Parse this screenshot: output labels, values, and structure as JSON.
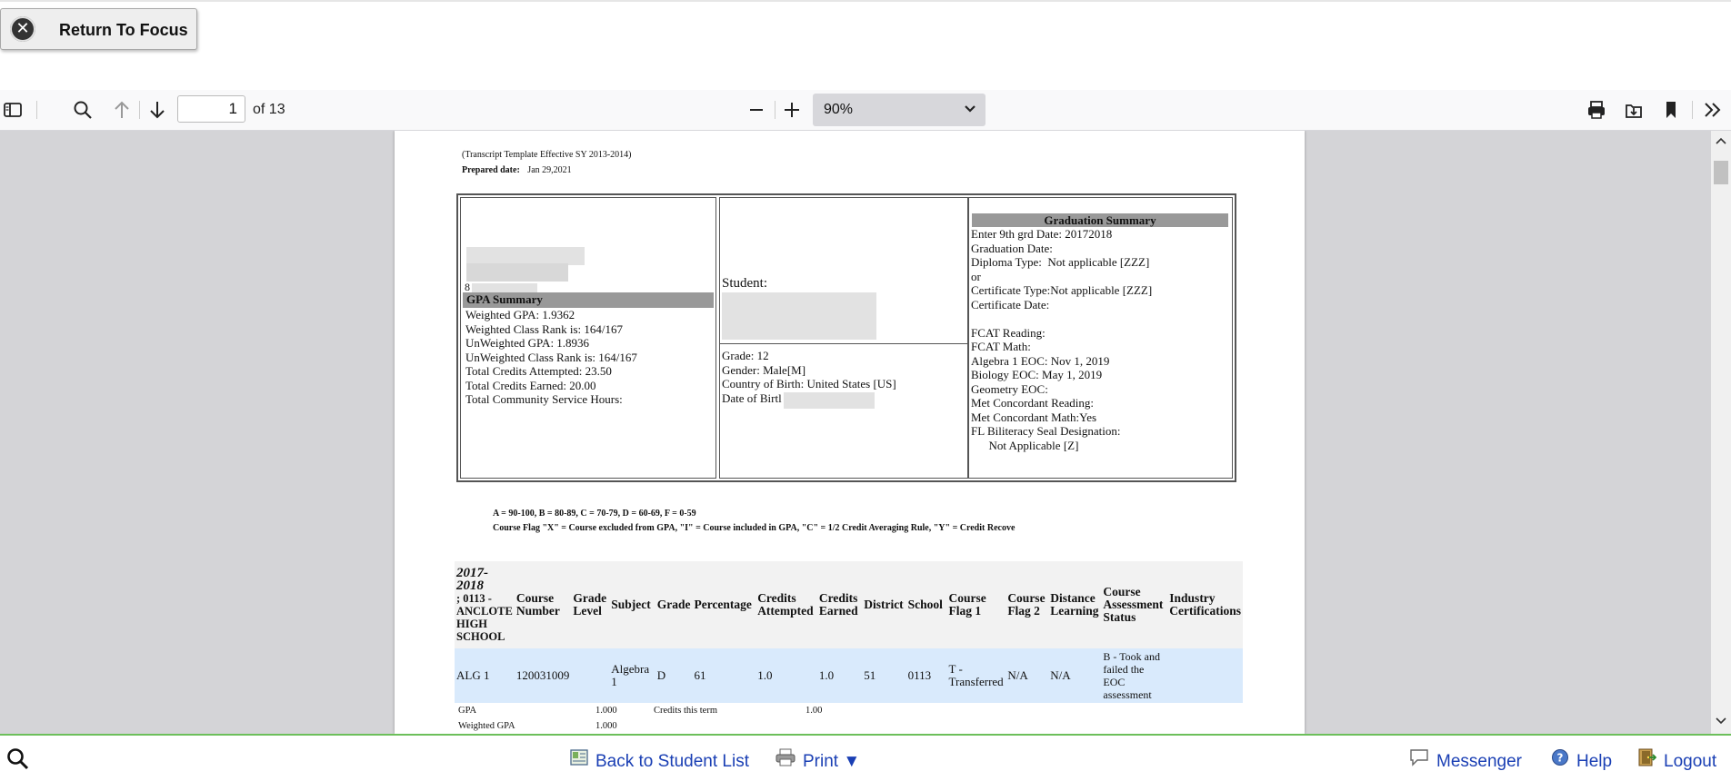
{
  "return_focus": {
    "label": "Return To Focus"
  },
  "toolbar": {
    "page_current": "1",
    "page_of": "of 13",
    "zoom": "90%"
  },
  "doc": {
    "template_line": "(Transcript Template Effective SY 2013-2014)",
    "prepared_label": "Prepared date:",
    "prepared_value": "Jan 29,2021",
    "box1_partial": "8",
    "gpa_summary": {
      "header": "GPA Summary",
      "lines": [
        "Weighted GPA:  1.9362",
        "Weighted Class Rank is:  164/167",
        "UnWeighted GPA: 1.8936",
        "UnWeighted Class Rank is: 164/167",
        "Total Credits Attempted: 23.50",
        "Total Credits Earned: 20.00",
        "Total Community Service Hours:"
      ]
    },
    "student": {
      "label": "Student:",
      "lines": [
        "Grade: 12",
        "Gender:  Male[M]",
        "Country of Birth: United States [US]",
        "Date of Birtl"
      ]
    },
    "graduation": {
      "header": "Graduation Summary",
      "lines": [
        "Enter 9th grd Date: 20172018",
        "Graduation Date:",
        "Diploma Type:  Not applicable [ZZZ]",
        "or",
        "Certificate Type:Not applicable [ZZZ]",
        "Certificate Date:",
        "",
        "FCAT Reading:",
        "FCAT Math:",
        "Algebra 1 EOC: Nov 1, 2019",
        "Biology EOC: May 1, 2019",
        "Geometry EOC:",
        "Met Concordant Reading:",
        "Met Concordant Math:Yes",
        "FL Biliteracy Seal Designation:",
        "      Not Applicable [Z]"
      ]
    },
    "legend1": "A = 90-100, B = 80-89, C = 70-79, D = 60-69, F = 0-59",
    "legend2": "Course Flag \"X\" = Course excluded from GPA, \"I\" = Course included in GPA, \"C\" = 1/2 Credit Averaging Rule, \"Y\" = Credit Recove",
    "course_table": {
      "headers": [
        "2017-2018 ; 0113 - ANCLOTE HIGH SCHOOL",
        "Course Number",
        "Grade Level",
        "Subject",
        "Grade",
        "Percentage",
        "Credits Attempted",
        "Credits Earned",
        "District",
        "School",
        "Course Flag 1",
        "Course Flag 2",
        "Distance Learning",
        "Course Assessment Status",
        "Industry Certifications"
      ],
      "row": [
        "ALG 1",
        "120031009",
        "",
        "Algebra 1",
        "D",
        "61",
        "1.0",
        "1.0",
        "51",
        "0113",
        "T - Transferred",
        "N/A",
        "N/A",
        "B - Took and failed the EOC assessment",
        ""
      ]
    },
    "summary_rows": {
      "gpa_label": "GPA",
      "gpa_value": "1.000",
      "credits_label": "Credits this term",
      "credits_value": "1.00",
      "wgpa_label": "Weighted GPA",
      "wgpa_value": "1.000"
    }
  },
  "footer": {
    "back": "Back to Student List",
    "print": "Print ▼",
    "messenger": "Messenger",
    "help": "Help",
    "logout": "Logout"
  }
}
